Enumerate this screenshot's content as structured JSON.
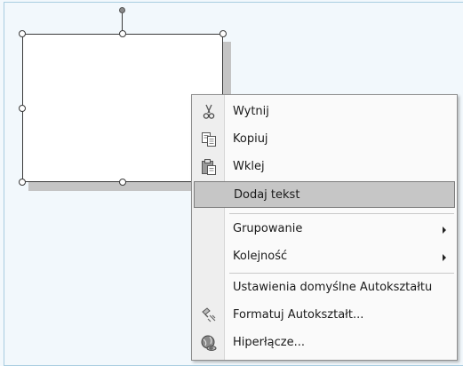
{
  "menu": {
    "items": [
      {
        "label": "Wytnij",
        "icon": "scissors-icon"
      },
      {
        "label": "Kopiuj",
        "icon": "copy-icon"
      },
      {
        "label": "Wklej",
        "icon": "paste-icon"
      },
      {
        "label": "Dodaj tekst",
        "highlighted": true
      },
      {
        "label": "Grupowanie",
        "submenu": true
      },
      {
        "label": "Kolejność",
        "submenu": true
      },
      {
        "label": "Ustawienia domyślne Autokształtu"
      },
      {
        "label": "Formatuj Autokształt...",
        "icon": "format-autoshape-icon"
      },
      {
        "label": "Hiperłącze...",
        "icon": "hyperlink-globe-icon"
      }
    ]
  },
  "colors": {
    "background": "#f2f8fc",
    "highlight": "#c6c6c6",
    "frame": "#a9cde0"
  }
}
